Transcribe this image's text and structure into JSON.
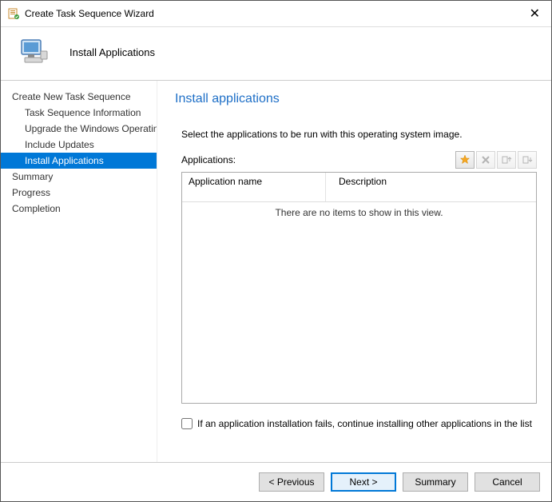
{
  "window": {
    "title": "Create Task Sequence Wizard",
    "close": "✕"
  },
  "header": {
    "text": "Install Applications"
  },
  "sidebar": {
    "items": [
      {
        "label": "Create New Task Sequence"
      },
      {
        "label": "Task Sequence Information"
      },
      {
        "label": "Upgrade the Windows Operating System"
      },
      {
        "label": "Include Updates"
      },
      {
        "label": "Install Applications"
      },
      {
        "label": "Summary"
      },
      {
        "label": "Progress"
      },
      {
        "label": "Completion"
      }
    ]
  },
  "main": {
    "heading": "Install applications",
    "description": "Select the applications to be run with this operating system image.",
    "applications_label": "Applications:",
    "columns": {
      "name": "Application name",
      "description": "Description"
    },
    "empty_text": "There are no items to show in this view.",
    "checkbox_label": "If an application installation fails, continue installing other applications in the list"
  },
  "footer": {
    "previous": "< Previous",
    "next": "Next >",
    "summary": "Summary",
    "cancel": "Cancel"
  }
}
